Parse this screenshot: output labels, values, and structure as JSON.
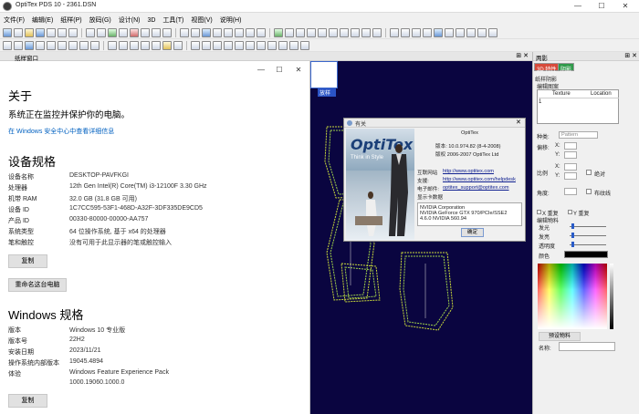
{
  "window": {
    "title": "OptiTex PDS 10 - 2361.DSN",
    "minimize_glyph": "—",
    "maximize_glyph": "☐",
    "close_glyph": "✕"
  },
  "menu": {
    "items": [
      "文件(F)",
      "编辑(E)",
      "纸样(P)",
      "放码(G)",
      "设计(N)",
      "3D",
      "工具(T)",
      "视图(V)",
      "说明(H)"
    ]
  },
  "panes": {
    "left_header": "纸样窗口",
    "right_header": "两影"
  },
  "canvas": {
    "tab_label": "放样",
    "background": "#0a0540"
  },
  "windows_about": {
    "controls": [
      "—",
      "☐",
      "✕"
    ],
    "about_title": "关于",
    "protection_text": "系统正在监控并保护你的电脑。",
    "security_link": "在 Windows 安全中心中查看详细信息",
    "device_spec_title": "设备规格",
    "device_specs": [
      {
        "label": "设备名称",
        "value": "DESKTOP-PAVFKGI"
      },
      {
        "label": "处理器",
        "value": "12th Gen Intel(R) Core(TM) i3-12100F   3.30 GHz"
      },
      {
        "label": "机带 RAM",
        "value": "32.0 GB (31.8 GB 可用)"
      },
      {
        "label": "设备 ID",
        "value": "1C7CC595-53F1-468D-A32F-3DF335DE9CD5"
      },
      {
        "label": "产品 ID",
        "value": "00330-80000-00000-AA757"
      },
      {
        "label": "系统类型",
        "value": "64 位操作系统, 基于 x64 的处理器"
      },
      {
        "label": "笔和触控",
        "value": "没有可用于此显示器的笔或触控输入"
      }
    ],
    "copy_button": "复制",
    "rename_button": "重命名这台电脑",
    "windows_spec_title": "Windows 规格",
    "windows_specs": [
      {
        "label": "版本",
        "value": "Windows 10 专业版"
      },
      {
        "label": "版本号",
        "value": "22H2"
      },
      {
        "label": "安装日期",
        "value": "2023/11/21"
      },
      {
        "label": "操作系统内部版本",
        "value": "19045.4894"
      },
      {
        "label": "体验",
        "value": "Windows Feature Experience Pack"
      },
      {
        "label": "",
        "value": "1000.19060.1000.0"
      }
    ],
    "copy_button_2": "复制"
  },
  "optitex_about": {
    "dialog_title": "有关",
    "logo_text": "OptiTex",
    "slogan": "Think in Style",
    "product": "OptiTex",
    "version_line": "版本: 10.0.974.82 (8-4-2008)",
    "copyright_line": "版权 2006-2007 OptiTex Ltd",
    "website_label": "互联网站",
    "website_url": "http://www.optitex.com",
    "support_label": "支援:",
    "support_url": "http://www.optitex.com/helpdesk",
    "email_label": "电子邮件:",
    "email": "optitex_support@optitex.com",
    "display_info_label": "显示卡数据",
    "gpu_lines": [
      "NVIDIA Corporation",
      "NVIDIA GeForce GTX 970/PCIe/SSE2",
      "4.6.0 NVIDIA 560.94"
    ],
    "ok_button": "确定"
  },
  "properties_panel": {
    "tabs": [
      "3D 特性",
      "阴影"
    ],
    "shading_label": "纸样阴影",
    "edit_pattern_label": "编辑图案",
    "table_headers": [
      "Texture",
      "Location"
    ],
    "row_number": "1",
    "type_label": "种类:",
    "type_value": "Pattern",
    "scale_label": "偏移:",
    "x_label": "X:",
    "y_label": "Y:",
    "ratio_label": "比例",
    "absolute_label": "绝对",
    "angle_label": "角度:",
    "bleed_label": "布纹线",
    "x_repeat": "X 重复",
    "y_repeat": "Y 重复",
    "edit_material_label": "编辑物料",
    "transparent_light": "发光",
    "highlight": "发亮",
    "transparency": "透明度",
    "color_label": "颜色",
    "color_value": "#000000",
    "preset_button": "预设物料",
    "name_label": "名称:"
  }
}
